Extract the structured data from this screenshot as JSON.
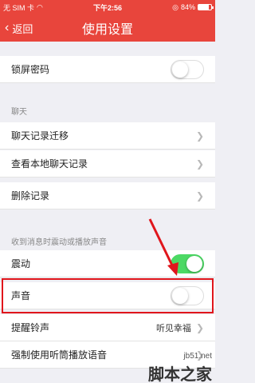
{
  "status": {
    "carrier": "无 SIM 卡",
    "time": "下午2:56",
    "battery": "84%",
    "battery_level": 0.84
  },
  "nav": {
    "back_label": "返回",
    "title": "使用设置"
  },
  "rows": {
    "lock": {
      "label": "锁屏密码",
      "toggle": "off"
    },
    "chat_section": "聊天",
    "migrate": {
      "label": "聊天记录迁移"
    },
    "view_local": {
      "label": "查看本地聊天记录"
    },
    "delete": {
      "label": "删除记录"
    },
    "sound_section": "收到消息时震动或播放声音",
    "vibrate": {
      "label": "震动",
      "toggle": "on"
    },
    "sound": {
      "label": "声音",
      "toggle": "off"
    },
    "ringtone": {
      "label": "提醒铃声",
      "value": "听见幸福"
    },
    "earpiece": {
      "label": "强制使用听筒播放语音"
    }
  },
  "watermark": {
    "site": "jb51.net",
    "brand": "脚本之家"
  }
}
